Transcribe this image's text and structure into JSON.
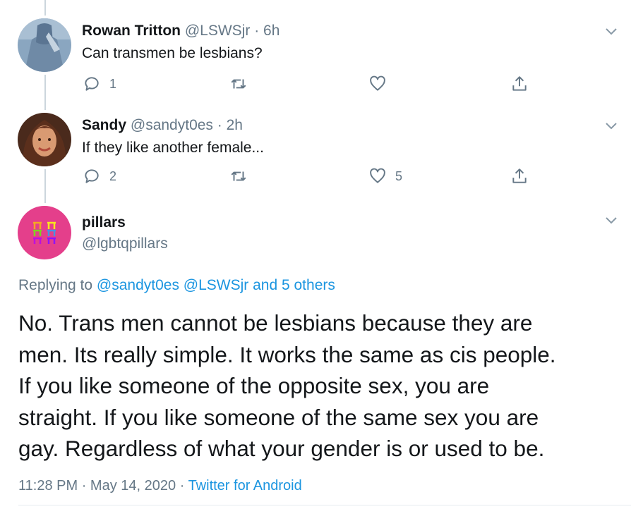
{
  "tweets": [
    {
      "name": "Rowan Tritton",
      "handle": "@LSWSjr",
      "dot": "·",
      "time": "6h",
      "text": "Can transmen be lesbians?",
      "reply_count": "1",
      "retweet_count": "",
      "like_count": "",
      "avatar_icon": "avatar-rowan"
    },
    {
      "name": "Sandy",
      "handle": "@sandyt0es",
      "dot": "·",
      "time": "2h",
      "text": "If they like another female...",
      "reply_count": "2",
      "retweet_count": "",
      "like_count": "5",
      "avatar_icon": "avatar-sandy"
    }
  ],
  "main_tweet": {
    "name": "pillars",
    "handle": "@lgbtqpillars",
    "replying_prefix": "Replying to",
    "mentions": "@sandyt0es @LSWSjr and 5 others",
    "text_lines": [
      "No. Trans men cannot be lesbians because they are",
      "men. Its really simple. It works the same as cis people.",
      "If you like someone of the opposite sex, you are",
      "straight. If you like someone of the same sex you are",
      "gay. Regardless of what your gender is or used to be."
    ],
    "time": "11:28 PM",
    "dot": "·",
    "date": "May 14, 2020",
    "dot2": "·",
    "source": "Twitter for Android"
  },
  "colors": {
    "text_primary": "#14171a",
    "text_secondary": "#657786",
    "link": "#1b95e0",
    "thread_line": "#ccd6dd",
    "pillars_avatar_bg": "#e43f8b"
  },
  "icons": [
    "reply-icon",
    "retweet-icon",
    "like-icon",
    "share-icon",
    "chevron-down-icon"
  ]
}
